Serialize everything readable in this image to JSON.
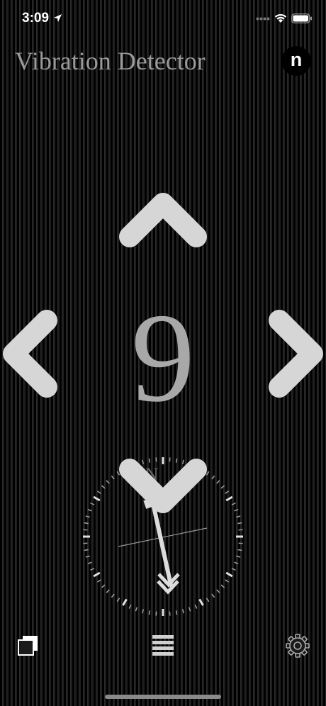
{
  "status": {
    "time": "3:09"
  },
  "header": {
    "title": "Vibration Detector",
    "n_button_label": "n"
  },
  "main": {
    "counter": "9"
  },
  "compass": {
    "north_label": "N"
  },
  "icons": {
    "location": "location-arrow-icon",
    "wifi": "wifi-icon",
    "battery": "battery-icon",
    "up": "chevron-up-icon",
    "down": "chevron-down-icon",
    "left": "chevron-left-icon",
    "right": "chevron-right-icon",
    "copy": "copy-icon",
    "menu": "menu-icon",
    "settings": "gear-icon"
  },
  "colors": {
    "arrow": "#d6d6d6",
    "title": "#9a9a9a",
    "counter": "#a8a8a8"
  }
}
